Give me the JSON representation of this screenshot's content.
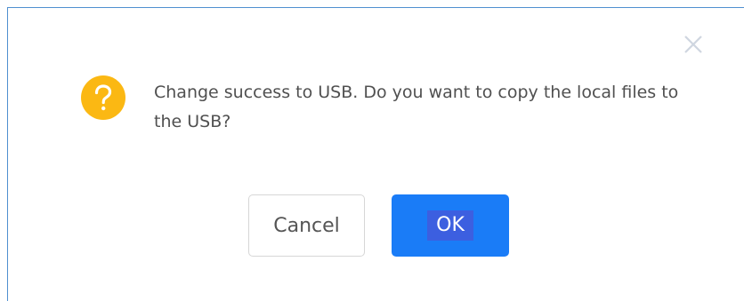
{
  "dialog": {
    "message": "Change success to USB. Do you want to copy the local files to the USB?",
    "icon": "question-icon",
    "close_icon": "close-icon",
    "cancel_label": "Cancel",
    "ok_label": "OK"
  },
  "colors": {
    "icon_background": "#fbb813",
    "primary_button": "#1a7cf7",
    "border_accent": "#4f8fd0"
  }
}
